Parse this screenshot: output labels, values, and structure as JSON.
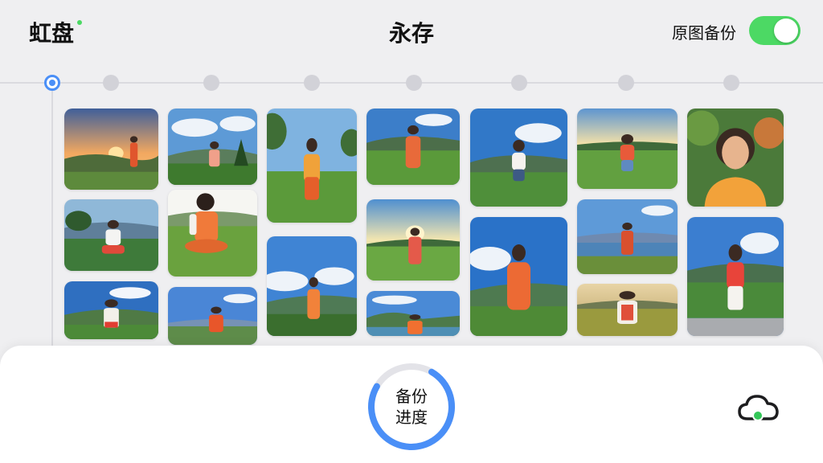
{
  "app": {
    "brand": "虹盘",
    "title": "永存"
  },
  "backup_toggle": {
    "label": "原图备份",
    "on": true
  },
  "timeline": {
    "dot_count": 8,
    "active_index": 0
  },
  "photos": {
    "count": 21
  },
  "backup_progress": {
    "line1": "备份",
    "line2": "进度",
    "progress": 0.75
  },
  "icons": {
    "sync": "cloud-sync-icon",
    "timeline": "timeline-dot-icon"
  },
  "colors": {
    "accent": "#4a8ff7",
    "toggle_on": "#4cd964",
    "background": "#efeff1"
  }
}
